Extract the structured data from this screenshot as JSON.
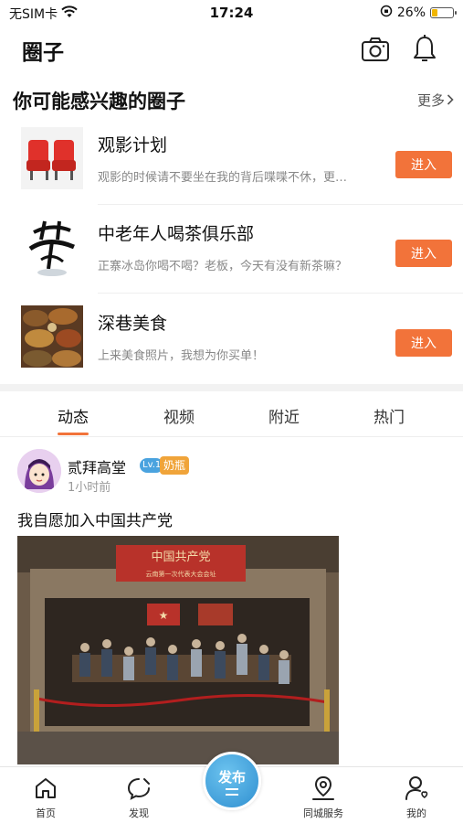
{
  "status_bar": {
    "carrier": "无SIM卡",
    "time": "17:24",
    "battery": "26%",
    "battery_level": 0.26
  },
  "header": {
    "title": "圈子"
  },
  "recommended": {
    "title": "你可能感兴趣的圈子",
    "more_label": "更多",
    "items": [
      {
        "name": "观影计划",
        "desc": "观影的时候请不要坐在我的背后喋喋不休，更…",
        "button": "进入"
      },
      {
        "name": "中老年人喝茶俱乐部",
        "desc": "正寨冰岛你喝不喝？老板，今天有没有新茶嘛？",
        "button": "进入"
      },
      {
        "name": "深巷美食",
        "desc": "上来美食照片，我想为你买单！",
        "button": "进入"
      }
    ]
  },
  "tabs": [
    {
      "label": "动态",
      "active": true
    },
    {
      "label": "视频",
      "active": false
    },
    {
      "label": "附近",
      "active": false
    },
    {
      "label": "热门",
      "active": false
    }
  ],
  "post": {
    "user": "贰拜高堂",
    "level": "Lv.1",
    "rank": "奶瓶",
    "time": "1小时前",
    "text": "我自愿加入中国共产党",
    "image_banner": "中国共产党",
    "image_subtitle": "云南第一次代表大会会址"
  },
  "bottom_nav": {
    "items": [
      {
        "label": "首页",
        "icon": "home-icon"
      },
      {
        "label": "发现",
        "icon": "discover-icon"
      },
      {
        "label": "同城服务",
        "icon": "location-icon"
      },
      {
        "label": "我的",
        "icon": "profile-icon"
      }
    ],
    "publish_label": "发布"
  },
  "colors": {
    "accent": "#f2733a",
    "publish": "#3a9ad9",
    "level_badge": "#4aa3df",
    "rank_badge": "#f0a43a"
  }
}
